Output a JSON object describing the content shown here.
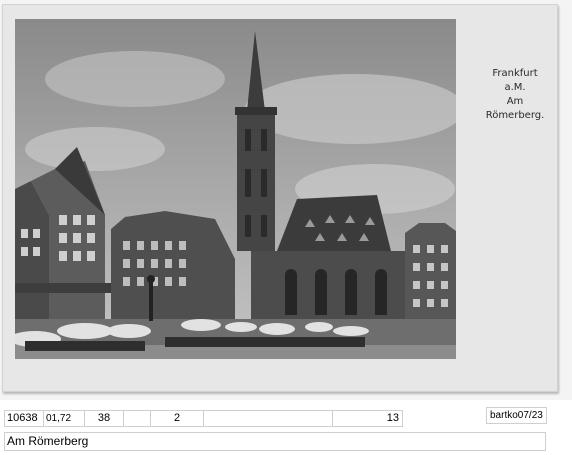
{
  "postcard": {
    "caption": {
      "line1": "Frankfurt",
      "line2": "a.M.",
      "line3": "Am",
      "line4": "Römerberg."
    }
  },
  "record": {
    "cells": [
      "10638",
      "01,72",
      "38",
      "",
      "2",
      "",
      "13"
    ],
    "signature": "bartko07/23",
    "title": "Am Römerberg"
  }
}
